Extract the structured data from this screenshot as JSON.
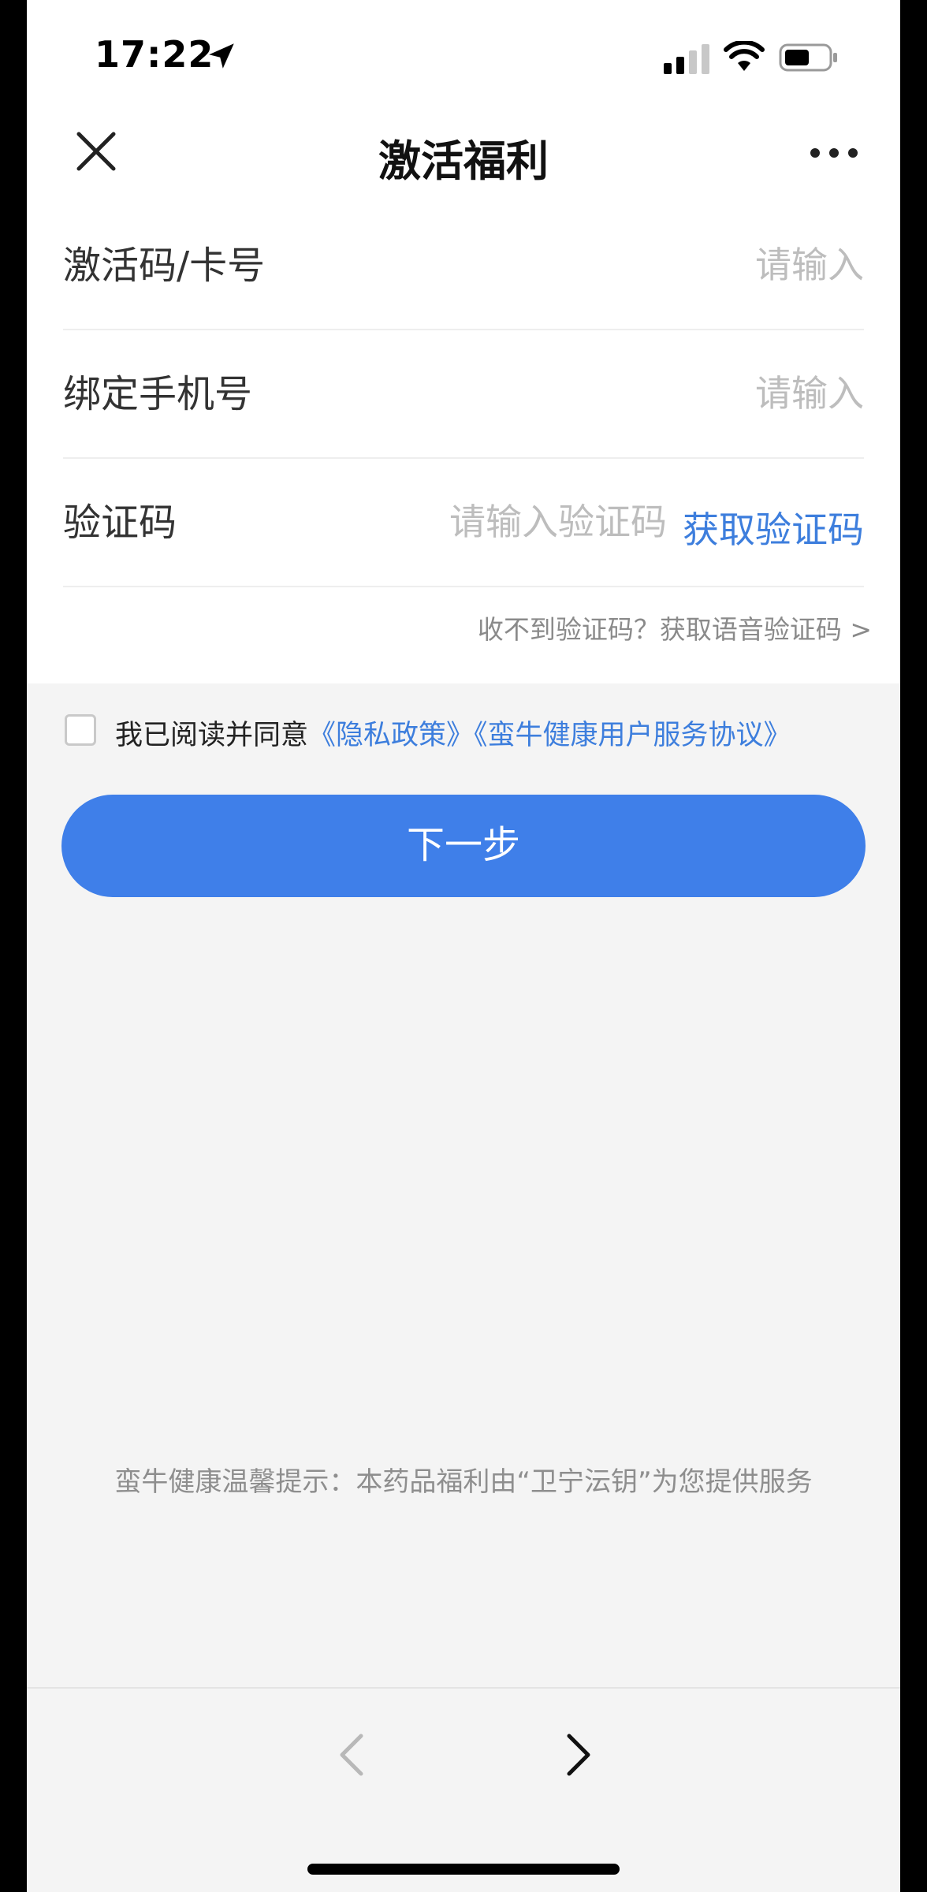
{
  "status_bar": {
    "time": "17:22",
    "icons": [
      "location-arrow-icon",
      "cellular-signal-icon",
      "wifi-icon",
      "battery-icon"
    ]
  },
  "nav": {
    "title": "激活福利",
    "close_icon": "close-icon",
    "more_icon": "more-icon"
  },
  "form": {
    "activation": {
      "label": "激活码/卡号",
      "placeholder": "请输入",
      "value": ""
    },
    "phone": {
      "label": "绑定手机号",
      "placeholder": "请输入",
      "value": ""
    },
    "code": {
      "label": "验证码",
      "placeholder": "请输入验证码",
      "value": "",
      "get_code": "获取验证码"
    },
    "voice_code": "收不到验证码？获取语音验证码 >"
  },
  "agreement": {
    "checked": false,
    "prefix": "我已阅读并同意",
    "privacy_link": "《隐私政策》",
    "service_link": "《蛮牛健康用户服务协议》"
  },
  "next_button": "下一步",
  "tip": "蛮牛健康温馨提示：本药品福利由“卫宁沄钥”为您提供服务",
  "toolbar": {
    "back_icon": "chevron-left-icon",
    "forward_icon": "chevron-right-icon"
  },
  "colors": {
    "accent": "#3f7fe9",
    "link": "#3d7edd",
    "placeholder": "#bdbdbd",
    "background": "#f4f4f4"
  }
}
